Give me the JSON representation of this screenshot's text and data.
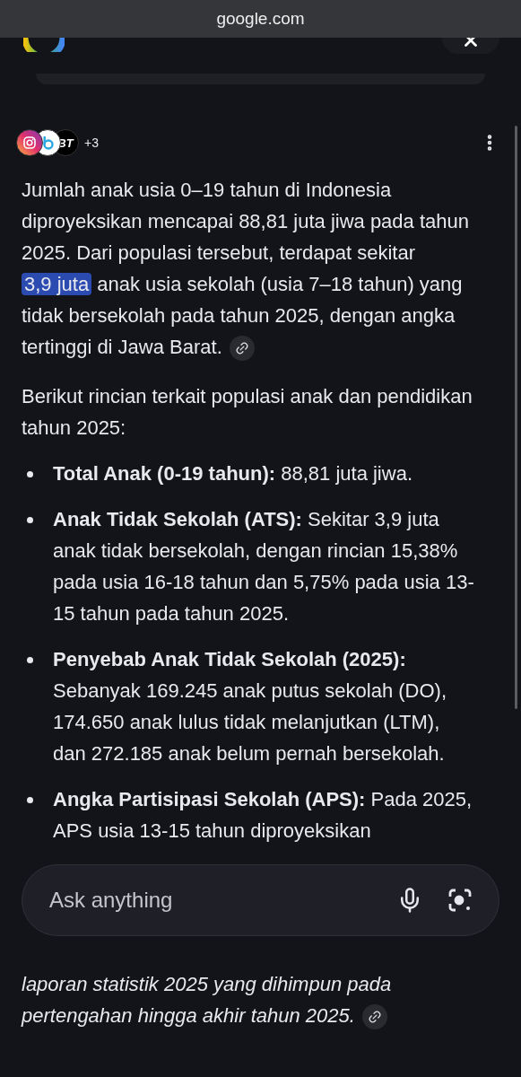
{
  "address_bar": {
    "domain": "google.com"
  },
  "sources": {
    "badges": [
      {
        "kind": "instagram"
      },
      {
        "kind": "ring-logo"
      },
      {
        "kind": "text-logo",
        "label": "BT"
      }
    ],
    "more": "+3"
  },
  "intro": {
    "before": "Jumlah anak usia 0–19 tahun di Indonesia diproyeksikan mencapai 88,81 juta jiwa pada tahun 2025. Dari populasi tersebut, terdapat sekitar ",
    "highlight": "3,9 juta",
    "after": " anak usia sekolah (usia 7–18 tahun) yang tidak bersekolah pada tahun 2025, dengan angka tertinggi di Jawa Barat."
  },
  "lead": "Berikut rincian terkait populasi anak dan pendidikan tahun 2025:",
  "bullets": [
    {
      "text": "**Total Anak (0-19 tahun):** 88,81 juta jiwa."
    },
    {
      "text": "**Anak Tidak Sekolah (ATS):** Sekitar 3,9 juta anak tidak bersekolah, dengan rincian 15,38% pada usia 16-18 tahun dan 5,75% pada usia 13-15 tahun pada tahun 2025."
    },
    {
      "text": "**Penyebab Anak Tidak Sekolah (2025):** Sebanyak 169.245 anak putus sekolah (DO), 174.650 anak lulus tidak melanjutkan (LTM), dan 272.185 anak belum pernah bersekolah."
    },
    {
      "text": "**Angka Partisipasi Sekolah (APS):** Pada 2025, APS usia 13-15 tahun diproyeksikan"
    }
  ],
  "ask_box": {
    "placeholder": "Ask anything"
  },
  "note": "laporan statistik 2025 yang dihimpun pada pertengahan hingga akhir tahun 2025."
}
